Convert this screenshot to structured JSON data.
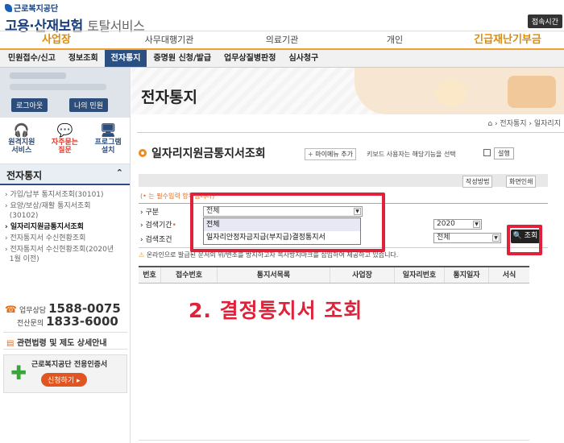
{
  "header": {
    "org": "근로복지공단",
    "title_main": "고용·산재보험",
    "title_sub": "토탈서비스",
    "login_time_btn": "접속시간"
  },
  "gnb": [
    "사업장",
    "사무대행기관",
    "의료기관",
    "개인",
    "긴급재난기부금"
  ],
  "lnb": [
    "민원접수/신고",
    "정보조회",
    "전자통지",
    "증명원 신청/발급",
    "업무상질병판정",
    "심사청구"
  ],
  "sidebar": {
    "logout": "로그아웃",
    "my_civil": "나의 민원",
    "quick": [
      {
        "l1": "원격지원",
        "l2": "서비스",
        "icon": "headset-icon"
      },
      {
        "l1": "자주묻는",
        "l2": "질문",
        "icon": "chat-icon"
      },
      {
        "l1": "프로그램",
        "l2": "설치",
        "icon": "monitor-icon"
      }
    ],
    "section_title": "전자통지",
    "section_chev": "⌃",
    "items": [
      "가입/납부 통지서조회(30101)",
      "요양/보상/재활 통지서조회",
      "(30102)",
      "일자리지원금통지서조회",
      "전자통지서 수신현황조회",
      "전자통지서 수신현황조회(2020년",
      "1월 이전)"
    ],
    "contact": {
      "biz_label": "업무상담",
      "biz_phone": "1588-0075",
      "it_label": "전산문의",
      "it_phone": "1833-6000"
    },
    "laws": "관련법령 및 제도 상세안내",
    "cert_text": "근로복지공단 전용인증서",
    "cert_btn": "신청하기"
  },
  "main": {
    "page_title": "전자통지",
    "breadcrumb": "⌂ › 전자통지 › 일자리지",
    "section_title": "일자리지원금통지서조회",
    "mymenu_plus": "+",
    "mymenu": "마이메뉴 추가",
    "kbd_text": "키보드 사용자는 해당기능을 선택",
    "kbd_btn": "설행",
    "tool_btn1": "작성방법",
    "tool_btn2": "화면인쇄",
    "req_note": "(• 는 필수입력 항목입니다)",
    "label_type": "구분",
    "label_period": "검색기간",
    "label_cond": "검색조건",
    "select_type": "전체",
    "dropdown_options": [
      "전체",
      "일자리안정자금지급(부지급)결정통지서"
    ],
    "select_year": "2020",
    "select_cond2": "전체",
    "search_btn": "조회",
    "notice": "온라인으로 발급된 문서의 위/변조를 방지하고자 복사방지마크를 삽입하여 제공하고 있습니다.",
    "table_headers": [
      "번호",
      "접수번호",
      "통지서목록",
      "사업장",
      "일자리번호",
      "통지일자",
      "서식"
    ],
    "overlay": "2. 결정통지서 조회"
  }
}
